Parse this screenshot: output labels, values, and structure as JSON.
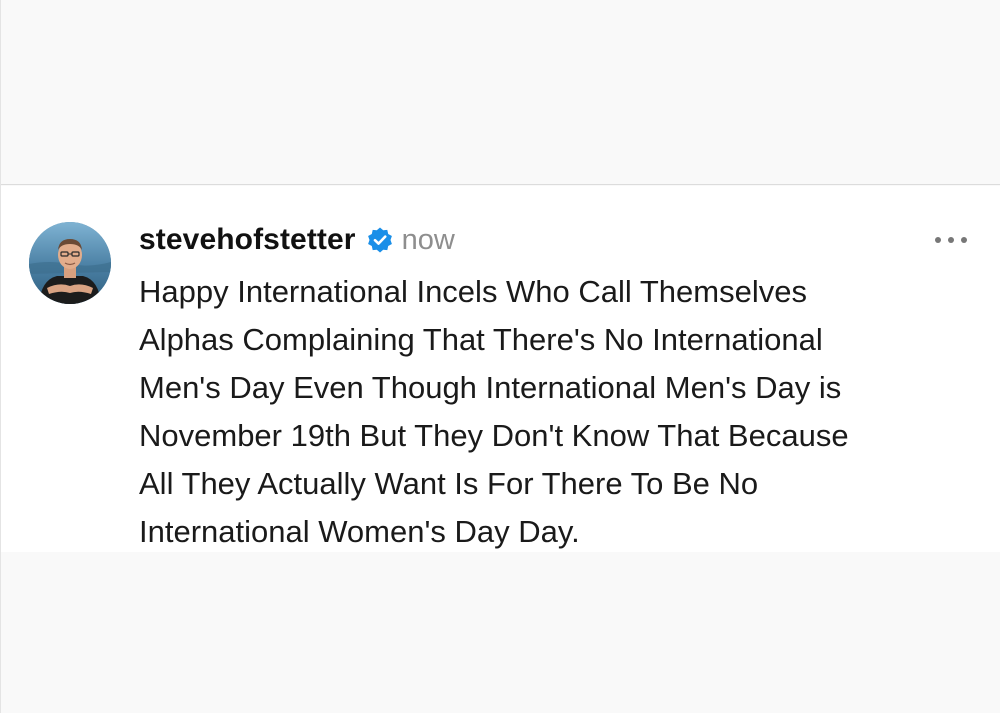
{
  "post": {
    "username": "stevehofstetter",
    "timestamp": "now",
    "caption_lines": [
      "Happy International Incels Who Call Themselves",
      "Alphas Complaining That There's No International",
      "Men's Day Even Though International Men's Day is",
      "November 19th But They Don't Know That Because",
      "All They Actually Want Is For There To Be No",
      "International Women's Day Day."
    ],
    "verified_icon": "verified-badge-icon",
    "more_icon": "more-options-icon",
    "colors": {
      "verified": "#1a8fe8",
      "timestamp": "#8e8e8e",
      "text": "#111111"
    }
  }
}
